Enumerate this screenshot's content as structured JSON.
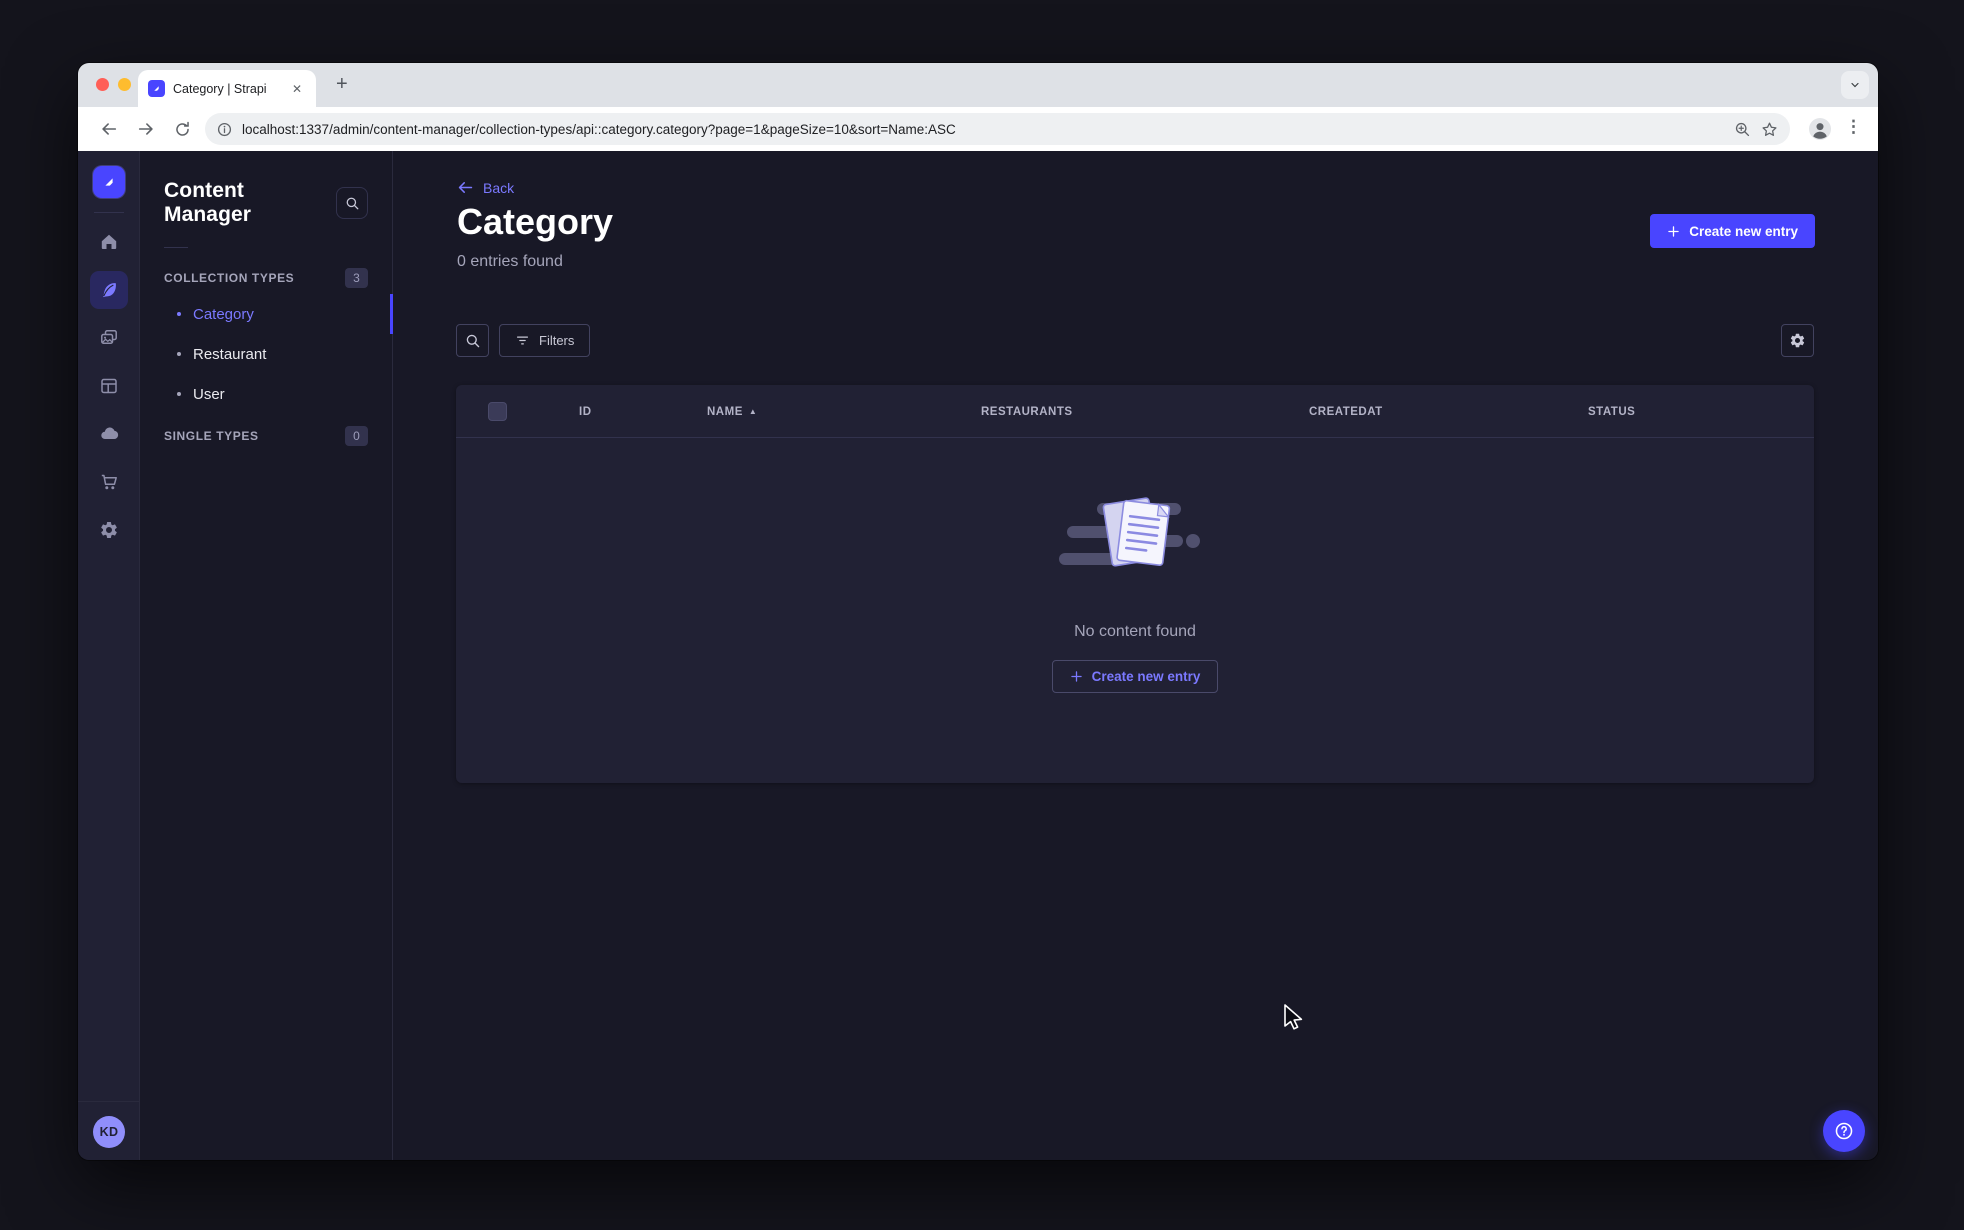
{
  "browser": {
    "tab_title": "Category | Strapi",
    "url": "localhost:1337/admin/content-manager/collection-types/api::category.category?page=1&pageSize=10&sort=Name:ASC",
    "icons": {
      "close_tab": "✕",
      "new_tab": "+",
      "menu": "⋮"
    }
  },
  "subnav": {
    "title": "Content Manager",
    "collection_types": {
      "label": "COLLECTION TYPES",
      "badge": "3"
    },
    "items": [
      {
        "label": "Category",
        "active": true
      },
      {
        "label": "Restaurant",
        "active": false
      },
      {
        "label": "User",
        "active": false
      }
    ],
    "single_types": {
      "label": "SINGLE TYPES",
      "badge": "0"
    }
  },
  "header": {
    "back_label": "Back",
    "title": "Category",
    "subtitle": "0 entries found",
    "create_button_label": "Create new entry"
  },
  "filters": {
    "label": "Filters"
  },
  "table": {
    "columns": [
      "ID",
      "NAME",
      "RESTAURANTS",
      "CREATEDAT",
      "STATUS"
    ],
    "sorted_column": "NAME",
    "sort_direction": "ASC",
    "sort_caret": "▲",
    "rows": []
  },
  "empty_state": {
    "message": "No content found",
    "create_button_label": "Create new entry"
  },
  "user": {
    "initials": "KD"
  },
  "colors": {
    "primary": "#4945ff",
    "primary_light": "#7b79ff",
    "app_bg": "#181826",
    "card_bg": "#212134",
    "muted_text": "#a5a5ba"
  }
}
